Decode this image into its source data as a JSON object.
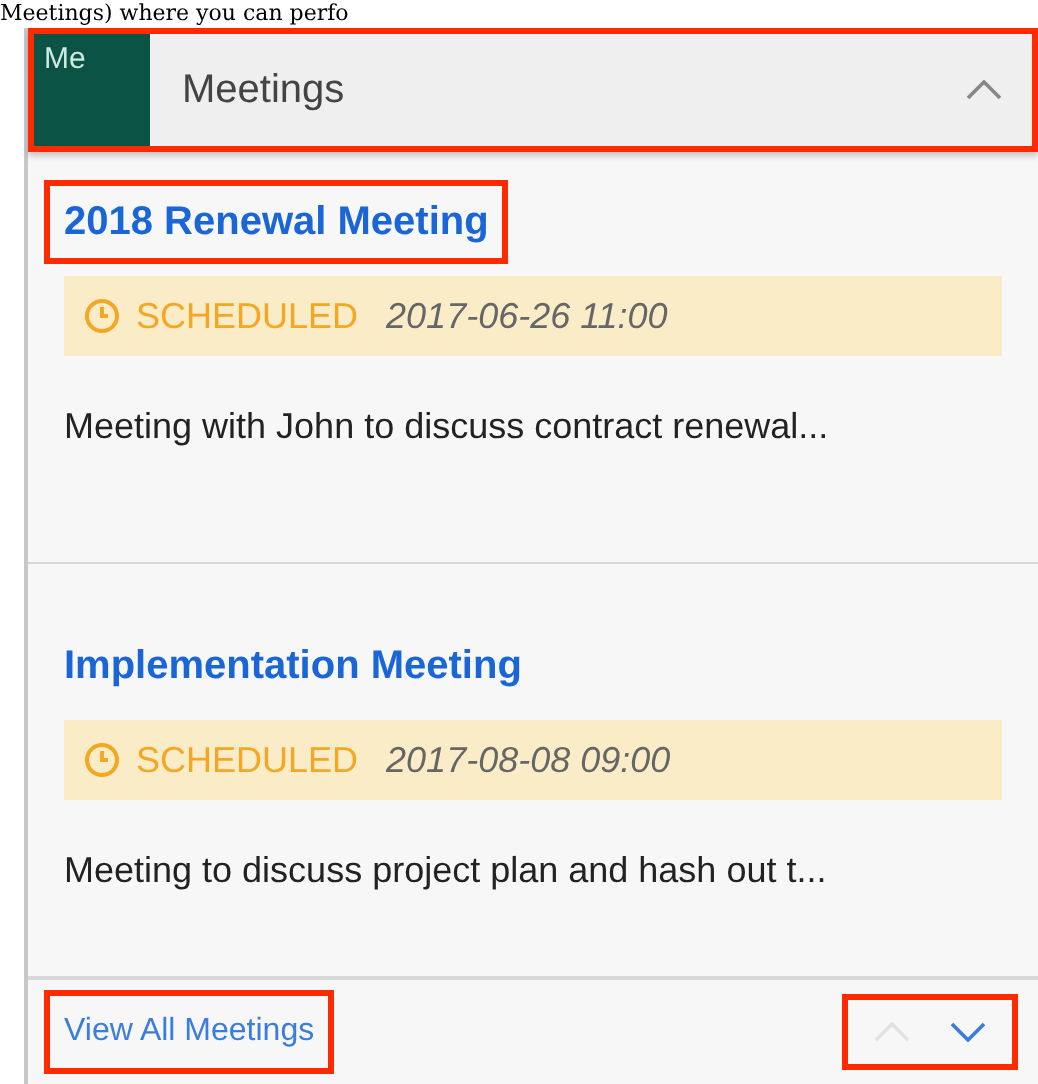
{
  "caption": "Meetings) where you can perfo",
  "panel": {
    "icon_text": "Me",
    "title": "Meetings",
    "expanded": true,
    "highlighted": true
  },
  "meetings": [
    {
      "title": "2018 Renewal Meeting",
      "highlighted": true,
      "status": "SCHEDULED",
      "datetime": "2017-06-26 11:00",
      "description": "Meeting with John to discuss contract renewal..."
    },
    {
      "title": "Implementation Meeting",
      "highlighted": false,
      "status": "SCHEDULED",
      "datetime": "2017-08-08 09:00",
      "description": "Meeting to discuss project plan and hash out t..."
    }
  ],
  "footer": {
    "link": "View All Meetings",
    "link_highlighted": true,
    "pager_highlighted": true,
    "can_go_up": false,
    "can_go_down": true
  }
}
